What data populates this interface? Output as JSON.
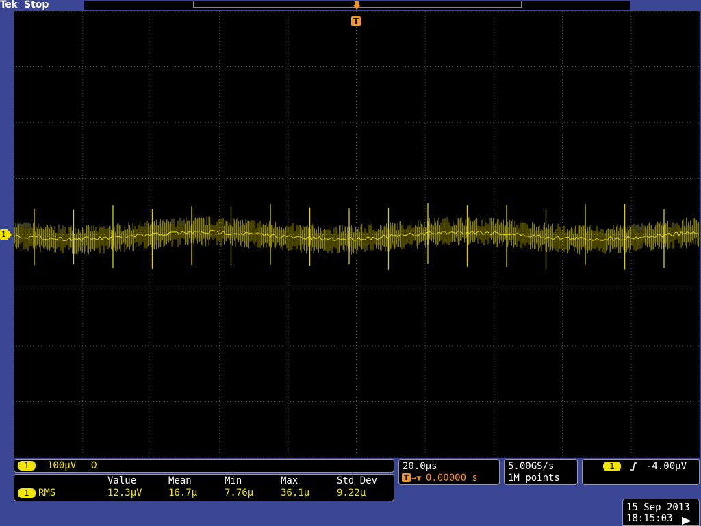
{
  "header": {
    "brand": "Tek",
    "run_status": "Stop"
  },
  "trigger_marker": {
    "label": "T"
  },
  "channel1": {
    "badge": "1",
    "scale": "100µV",
    "coupling_icon": "Ω",
    "trace_color": "#f2e600"
  },
  "measurement": {
    "channel_badge": "1",
    "type": "RMS",
    "headers": [
      "Value",
      "Mean",
      "Min",
      "Max",
      "Std Dev"
    ],
    "values": [
      "12.3µV",
      "16.7µ",
      "7.76µ",
      "36.1µ",
      "9.22µ"
    ]
  },
  "timebase": {
    "scale": "20.0µs",
    "trigger_icon": "T",
    "delay_prefix": "→▼",
    "delay": "0.00000 s"
  },
  "acquisition": {
    "sample_rate": "5.00GS/s",
    "record_length": "1M points"
  },
  "trigger": {
    "channel_badge": "1",
    "slope_icon": "rising-edge-icon",
    "level": "-4.00µV"
  },
  "datetime": {
    "date": "15 Sep 2013",
    "time": "18:15:03"
  },
  "colors": {
    "background": "#3a4593",
    "screen": "#000000",
    "trigger_orange": "#f7941d",
    "channel1_yellow": "#f2e600"
  }
}
